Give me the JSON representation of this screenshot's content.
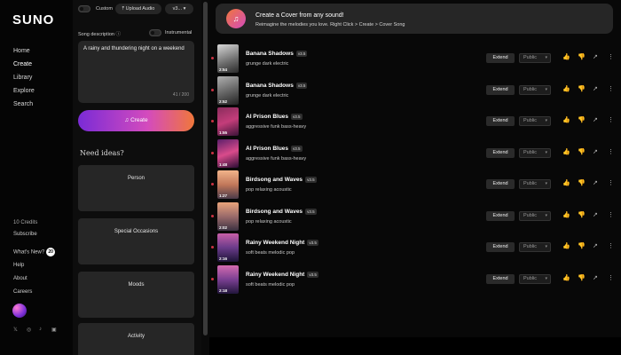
{
  "nav": {
    "logo": "SUNO",
    "items": [
      "Home",
      "Create",
      "Library",
      "Explore",
      "Search"
    ],
    "credits": "10 Credits",
    "subscribe": "Subscribe",
    "whats_new": "What's New?",
    "whats_new_badge": "20",
    "help": "Help",
    "about": "About",
    "careers": "Careers",
    "social": [
      "𝕏",
      "◎",
      "♪",
      "▣"
    ]
  },
  "panel": {
    "custom_label": "Custom",
    "upload_label": "Upload Audio",
    "version_label": "v3...",
    "desc_label": "Song description",
    "instrumental_label": "Instrumental",
    "description": "A rainy and thundering night on a weekend",
    "char_count": "41 / 200",
    "create_label": "Create",
    "need_ideas": "Need ideas?",
    "ideas": [
      "Person",
      "Special Occasions",
      "Moods",
      "Activity"
    ]
  },
  "banner": {
    "title": "Create a Cover from any sound!",
    "subtitle": "Reimagine the melodies you love. Right Click > Create > Cover Song"
  },
  "songs": [
    {
      "title": "Banana Shadows",
      "version": "v3.5",
      "tags": "grunge dark electric",
      "duration": "2:54",
      "thumb": "linear-gradient(160deg,#d8d8d8,#6a6a6a 60%,#2a2a2a)"
    },
    {
      "title": "Banana Shadows",
      "version": "v3.5",
      "tags": "grunge dark electric",
      "duration": "2:52",
      "thumb": "linear-gradient(160deg,#b0b0b0,#5a5a5a 60%,#222)"
    },
    {
      "title": "AI Prison Blues",
      "version": "v3.5",
      "tags": "aggressive funk bass-heavy",
      "duration": "1:55",
      "thumb": "linear-gradient(160deg,#8a2c5c,#c43d7a 50%,#3b1438)"
    },
    {
      "title": "AI Prison Blues",
      "version": "v3.5",
      "tags": "aggressive funk bass-heavy",
      "duration": "1:48",
      "thumb": "linear-gradient(160deg,#5a1f6a,#d94b8b 50%,#2a0c34)"
    },
    {
      "title": "Birdsong and Waves",
      "version": "v3.5",
      "tags": "pop relaxing acoustic",
      "duration": "1:27",
      "thumb": "linear-gradient(180deg,#f1b48a,#c2785a 50%,#4a3a4a)"
    },
    {
      "title": "Birdsong and Waves",
      "version": "v3.5",
      "tags": "pop relaxing acoustic",
      "duration": "2:02",
      "thumb": "linear-gradient(180deg,#e9a37b,#9a6a6a 50%,#3a3040)"
    },
    {
      "title": "Rainy Weekend Night",
      "version": "v3.5",
      "tags": "soft beats melodic pop",
      "duration": "2:16",
      "thumb": "linear-gradient(180deg,#c85fa8,#6a3b8a 50%,#1e1438)"
    },
    {
      "title": "Rainy Weekend Night",
      "version": "v3.5",
      "tags": "soft beats melodic pop",
      "duration": "2:18",
      "thumb": "linear-gradient(180deg,#d46bb0,#7a3f92 50%,#22163c)"
    }
  ],
  "row_actions": {
    "extend": "Extend",
    "public": "Public",
    "caret": "▾",
    "like": "👍",
    "dislike": "👎",
    "share": "↗",
    "more": "⋮"
  },
  "icons": {
    "banner_icon": "♫",
    "create_icon": "♫"
  }
}
